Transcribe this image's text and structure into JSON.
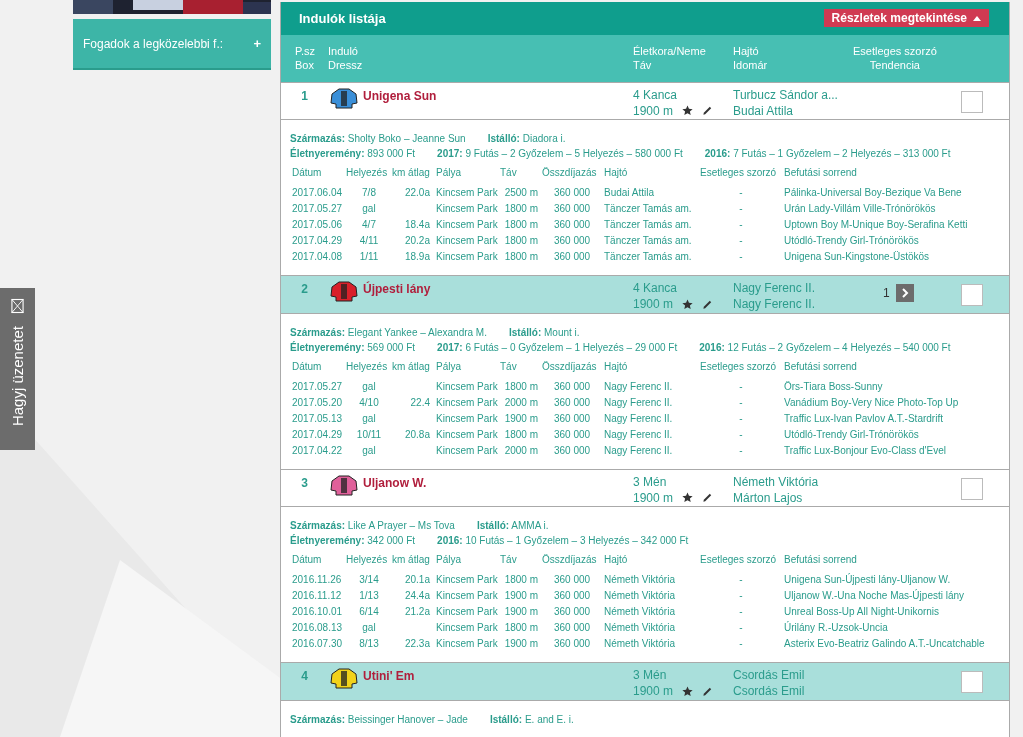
{
  "sidebar": {
    "bet_panel": {
      "label": "Fogadok a legközelebbi f.:",
      "toggle": "+"
    }
  },
  "feedback_tab": {
    "label": "Hagyj üzenetet"
  },
  "runners_panel": {
    "title": "Indulók listája",
    "details_button": {
      "label": "Részletek megtekintése",
      "expanded": true
    },
    "columns": [
      {
        "line1": "P.sz",
        "line2": "Box"
      },
      {
        "line1": "Induló",
        "line2": "Dressz"
      },
      {
        "line1": "Életkora/Neme",
        "line2": "Táv"
      },
      {
        "line1": "Hajtó",
        "line2": "Idomár"
      },
      {
        "line1": "Esetleges szorzó",
        "line2": "Tendencia"
      }
    ]
  },
  "runners": [
    {
      "number": "1",
      "name": "Unigena Sun",
      "color": "#3a8fd8",
      "age_sex": "4 Kanca",
      "distance": "1900 m",
      "driver": "Turbucz Sándor a...",
      "trainer": "Budai Attila",
      "shaded": false,
      "checked": false,
      "details": {
        "info_lines": [
          [
            "**Származás:** Sholty Boko – Jeanne Sun",
            "**Istálló:** Diadora i."
          ],
          [
            "**Életnyeremény:** 893 000 Ft",
            "**2017:** 9 Futás – 2 Győzelem – 5 Helyezés – 580 000 Ft",
            "**2016:** 7 Futás – 1 Győzelem – 2 Helyezés – 313 000 Ft"
          ]
        ],
        "history_columns": [
          "Dátum",
          "Helyezés",
          "km átlag",
          "Pálya",
          "Táv",
          "Összdíjazás",
          "Hajtó",
          "Esetleges szorzó",
          "Befutási sorrend"
        ],
        "history": [
          {
            "date": "2017.06.04",
            "place": "7/8",
            "km_avg": "22.0a",
            "track": "Kincsem Park",
            "distance": "2500 m",
            "prize": "360 000",
            "driver": "Budai Attila",
            "odds": "-",
            "finish_order": "Pálinka-Universal Boy-Bezique Va Bene"
          },
          {
            "date": "2017.05.27",
            "place": "gal",
            "track": "Kincsem Park",
            "distance": "1800 m",
            "prize": "360 000",
            "driver": "Tänczer Tamás am.",
            "odds": "-",
            "finish_order": "Urán Lady-Villám Ville-Trónörökös"
          },
          {
            "date": "2017.05.06",
            "place": "4/7",
            "km_avg": "18.4a",
            "track": "Kincsem Park",
            "distance": "1800 m",
            "prize": "360 000",
            "driver": "Tänczer Tamás am.",
            "odds": "-",
            "finish_order": "Uptown Boy M-Unique Boy-Serafina Ketti"
          },
          {
            "date": "2017.04.29",
            "place": "4/11",
            "km_avg": "20.2a",
            "track": "Kincsem Park",
            "distance": "1800 m",
            "prize": "360 000",
            "driver": "Tänczer Tamás am.",
            "odds": "-",
            "finish_order": "Utódló-Trendy Girl-Trónörökös"
          },
          {
            "date": "2017.04.08",
            "place": "1/11",
            "km_avg": "18.9a",
            "track": "Kincsem Park",
            "distance": "1800 m",
            "prize": "360 000",
            "driver": "Tänczer Tamás am.",
            "odds": "-",
            "finish_order": "Unigena Sun-Kingstone-Üstökös"
          }
        ]
      }
    },
    {
      "number": "2",
      "name": "Újpesti lány",
      "color": "#d8202a",
      "age_sex": "4 Kanca",
      "distance": "1900 m",
      "driver": "Nagy Ferenc II.",
      "trainer": "Nagy Ferenc II.",
      "shaded": true,
      "checked": false,
      "odds": "1",
      "details": {
        "info_lines": [
          [
            "**Származás:** Elegant Yankee – Alexandra M.",
            "**Istálló:** Mount i."
          ],
          [
            "**Életnyeremény:** 569 000 Ft",
            "**2017:** 6 Futás – 0 Győzelem – 1 Helyezés – 29 000 Ft",
            "**2016:** 12 Futás – 2 Győzelem – 4 Helyezés – 540 000 Ft"
          ]
        ],
        "history_columns": [
          "Dátum",
          "Helyezés",
          "km átlag",
          "Pálya",
          "Táv",
          "Összdíjazás",
          "Hajtó",
          "Esetleges szorzó",
          "Befutási sorrend"
        ],
        "history": [
          {
            "date": "2017.05.27",
            "place": "gal",
            "track": "Kincsem Park",
            "distance": "1800 m",
            "prize": "360 000",
            "driver": "Nagy Ferenc II.",
            "odds": "-",
            "finish_order": "Örs-Tiara Boss-Sunny"
          },
          {
            "date": "2017.05.20",
            "place": "4/10",
            "km_avg": "22.4",
            "track": "Kincsem Park",
            "distance": "2000 m",
            "prize": "360 000",
            "driver": "Nagy Ferenc II.",
            "odds": "-",
            "finish_order": "Vanádium Boy-Very Nice Photo-Top Up"
          },
          {
            "date": "2017.05.13",
            "place": "gal",
            "track": "Kincsem Park",
            "distance": "1900 m",
            "prize": "360 000",
            "driver": "Nagy Ferenc II.",
            "odds": "-",
            "finish_order": "Traffic Lux-Ivan Pavlov A.T.-Stardrift"
          },
          {
            "date": "2017.04.29",
            "place": "10/11",
            "km_avg": "20.8a",
            "track": "Kincsem Park",
            "distance": "1800 m",
            "prize": "360 000",
            "driver": "Nagy Ferenc II.",
            "odds": "-",
            "finish_order": "Utódló-Trendy Girl-Trónörökös"
          },
          {
            "date": "2017.04.22",
            "place": "gal",
            "track": "Kincsem Park",
            "distance": "2000 m",
            "prize": "360 000",
            "driver": "Nagy Ferenc II.",
            "odds": "-",
            "finish_order": "Traffic Lux-Bonjour Evo-Class d'Evel"
          }
        ]
      }
    },
    {
      "number": "3",
      "name": "Uljanow W.",
      "color": "#e0609a",
      "age_sex": "3 Mén",
      "distance": "1900 m",
      "driver": "Németh Viktória",
      "trainer": "Márton Lajos",
      "shaded": false,
      "checked": false,
      "details": {
        "info_lines": [
          [
            "**Származás:** Like A Prayer – Ms Tova",
            "**Istálló:** AMMA i."
          ],
          [
            "**Életnyeremény:** 342 000 Ft",
            "**2016:** 10 Futás – 1 Győzelem – 3 Helyezés – 342 000 Ft"
          ]
        ],
        "history_columns": [
          "Dátum",
          "Helyezés",
          "km átlag",
          "Pálya",
          "Táv",
          "Összdíjazás",
          "Hajtó",
          "Esetleges szorzó",
          "Befutási sorrend"
        ],
        "history": [
          {
            "date": "2016.11.26",
            "place": "3/14",
            "km_avg": "20.1a",
            "track": "Kincsem Park",
            "distance": "1800 m",
            "prize": "360 000",
            "driver": "Németh Viktória",
            "odds": "-",
            "finish_order": "Unigena Sun-Újpesti lány-Uljanow W."
          },
          {
            "date": "2016.11.12",
            "place": "1/13",
            "km_avg": "24.4a",
            "track": "Kincsem Park",
            "distance": "1900 m",
            "prize": "360 000",
            "driver": "Németh Viktória",
            "odds": "-",
            "finish_order": "Uljanow W.-Una Noche Mas-Újpesti lány"
          },
          {
            "date": "2016.10.01",
            "place": "6/14",
            "km_avg": "21.2a",
            "track": "Kincsem Park",
            "distance": "1900 m",
            "prize": "360 000",
            "driver": "Németh Viktória",
            "odds": "-",
            "finish_order": "Unreal Boss-Up All Night-Unikornis"
          },
          {
            "date": "2016.08.13",
            "place": "gal",
            "track": "Kincsem Park",
            "distance": "1800 m",
            "prize": "360 000",
            "driver": "Németh Viktória",
            "odds": "-",
            "finish_order": "Úrilány R.-Uzsok-Uncia"
          },
          {
            "date": "2016.07.30",
            "place": "8/13",
            "km_avg": "22.3a",
            "track": "Kincsem Park",
            "distance": "1900 m",
            "prize": "360 000",
            "driver": "Németh Viktória",
            "odds": "-",
            "finish_order": "Asterix Evo-Beatriz Galindo A.T.-Uncatchable"
          }
        ]
      }
    },
    {
      "number": "4",
      "name": "Utini' Em",
      "color": "#f2d21a",
      "age_sex": "3 Mén",
      "distance": "1900 m",
      "driver": "Csordás Emil",
      "trainer": "Csordás Emil",
      "shaded": true,
      "checked": false,
      "details": {
        "info_lines": [
          [
            "**Származás:** Beissinger Hanover – Jade",
            "**Istálló:** E. and E. i."
          ]
        ]
      }
    }
  ]
}
